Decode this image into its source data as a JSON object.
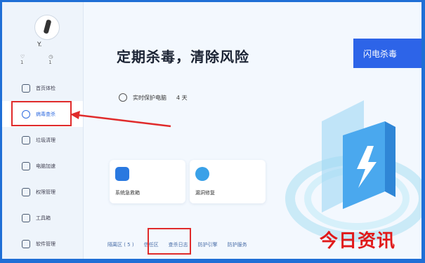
{
  "profile": {
    "username": "Y.",
    "stat_left": "1",
    "stat_right": "1"
  },
  "sidebar": {
    "items": [
      {
        "label": "首页体检",
        "icon": "home-check-icon"
      },
      {
        "label": "病毒查杀",
        "icon": "shield-icon"
      },
      {
        "label": "垃圾清理",
        "icon": "clean-icon"
      },
      {
        "label": "电脑加速",
        "icon": "rocket-icon"
      },
      {
        "label": "权限管理",
        "icon": "lock-icon"
      },
      {
        "label": "工具箱",
        "icon": "toolbox-icon"
      },
      {
        "label": "软件管理",
        "icon": "app-icon"
      }
    ]
  },
  "main": {
    "headline": "定期杀毒，清除风险",
    "protect_label": "实时保护电脑",
    "protect_days": "4 天",
    "scan_button": "闪电杀毒",
    "cards": [
      {
        "label": "系统急救箱",
        "icon": "first-aid-icon"
      },
      {
        "label": "漏洞修复",
        "icon": "patch-icon"
      }
    ],
    "bottom_links": [
      "隔离区 ( 5 )",
      "信任区",
      "查杀日志",
      "防护引擎",
      "防护服务"
    ]
  },
  "watermark": "今日资讯",
  "colors": {
    "accent": "#2d64e8",
    "annotation": "#e02b2b",
    "watermark": "#e11a1a"
  }
}
